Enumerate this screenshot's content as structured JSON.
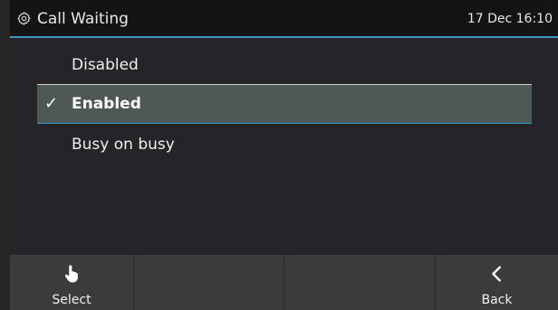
{
  "header": {
    "title": "Call Waiting",
    "clock": "17 Dec 16:10"
  },
  "list": {
    "selected_index": 1,
    "items": [
      {
        "label": "Disabled",
        "checked": false
      },
      {
        "label": "Enabled",
        "checked": true
      },
      {
        "label": "Busy on busy",
        "checked": false
      }
    ],
    "check_glyph": "✓"
  },
  "softkeys": [
    {
      "label": "Select",
      "icon": "hand-pointer-icon"
    },
    {
      "label": "",
      "icon": ""
    },
    {
      "label": "",
      "icon": ""
    },
    {
      "label": "Back",
      "icon": "chevron-left-icon"
    }
  ],
  "colors": {
    "accent": "#3b97c8",
    "selected_row": "#4e5856",
    "background": "#242429",
    "header": "#141417",
    "softkey_bar": "#3b3b3d"
  }
}
